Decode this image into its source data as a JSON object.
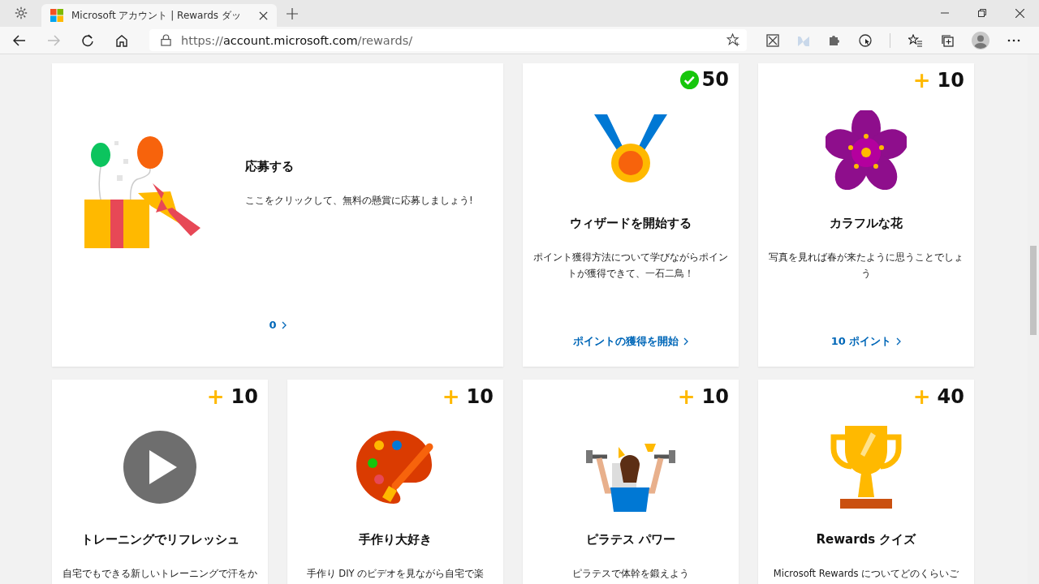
{
  "browser": {
    "tab": {
      "title": "Microsoft アカウント | Rewards ダッ"
    },
    "address": {
      "scheme": "https://",
      "host": "account.microsoft.com",
      "path": "/rewards/"
    }
  },
  "cards": [
    {
      "kind": "gift",
      "title": "応募する",
      "description": "ここをクリックして、無料の懸賞に応募しましょう!",
      "link": "0"
    },
    {
      "kind": "medal",
      "completed": true,
      "points": "50",
      "title": "ウィザードを開始する",
      "description": "ポイント獲得方法について学びながらポイントが獲得できて、一石二鳥！",
      "link": "ポイントの獲得を開始"
    },
    {
      "kind": "flower",
      "completed": false,
      "sign": "+",
      "points": "10",
      "title": "カラフルな花",
      "description": "写真を見れば春が来たように思うことでしょう",
      "link": "10 ポイント"
    },
    {
      "kind": "play",
      "completed": false,
      "sign": "+",
      "points": "10",
      "title": "トレーニングでリフレッシュ",
      "description": "自宅でもできる新しいトレーニングで汗をか"
    },
    {
      "kind": "palette",
      "completed": false,
      "sign": "+",
      "points": "10",
      "title": "手作り大好き",
      "description": "手作り DIY のビデオを見ながら自宅で楽"
    },
    {
      "kind": "fitness",
      "completed": false,
      "sign": "+",
      "points": "10",
      "title": "ピラテス パワー",
      "description": "ピラテスで体幹を鍛えよう"
    },
    {
      "kind": "trophy",
      "completed": false,
      "sign": "+",
      "points": "40",
      "title": "Rewards クイズ",
      "description": "Microsoft Rewards についてどのくらいご"
    }
  ]
}
